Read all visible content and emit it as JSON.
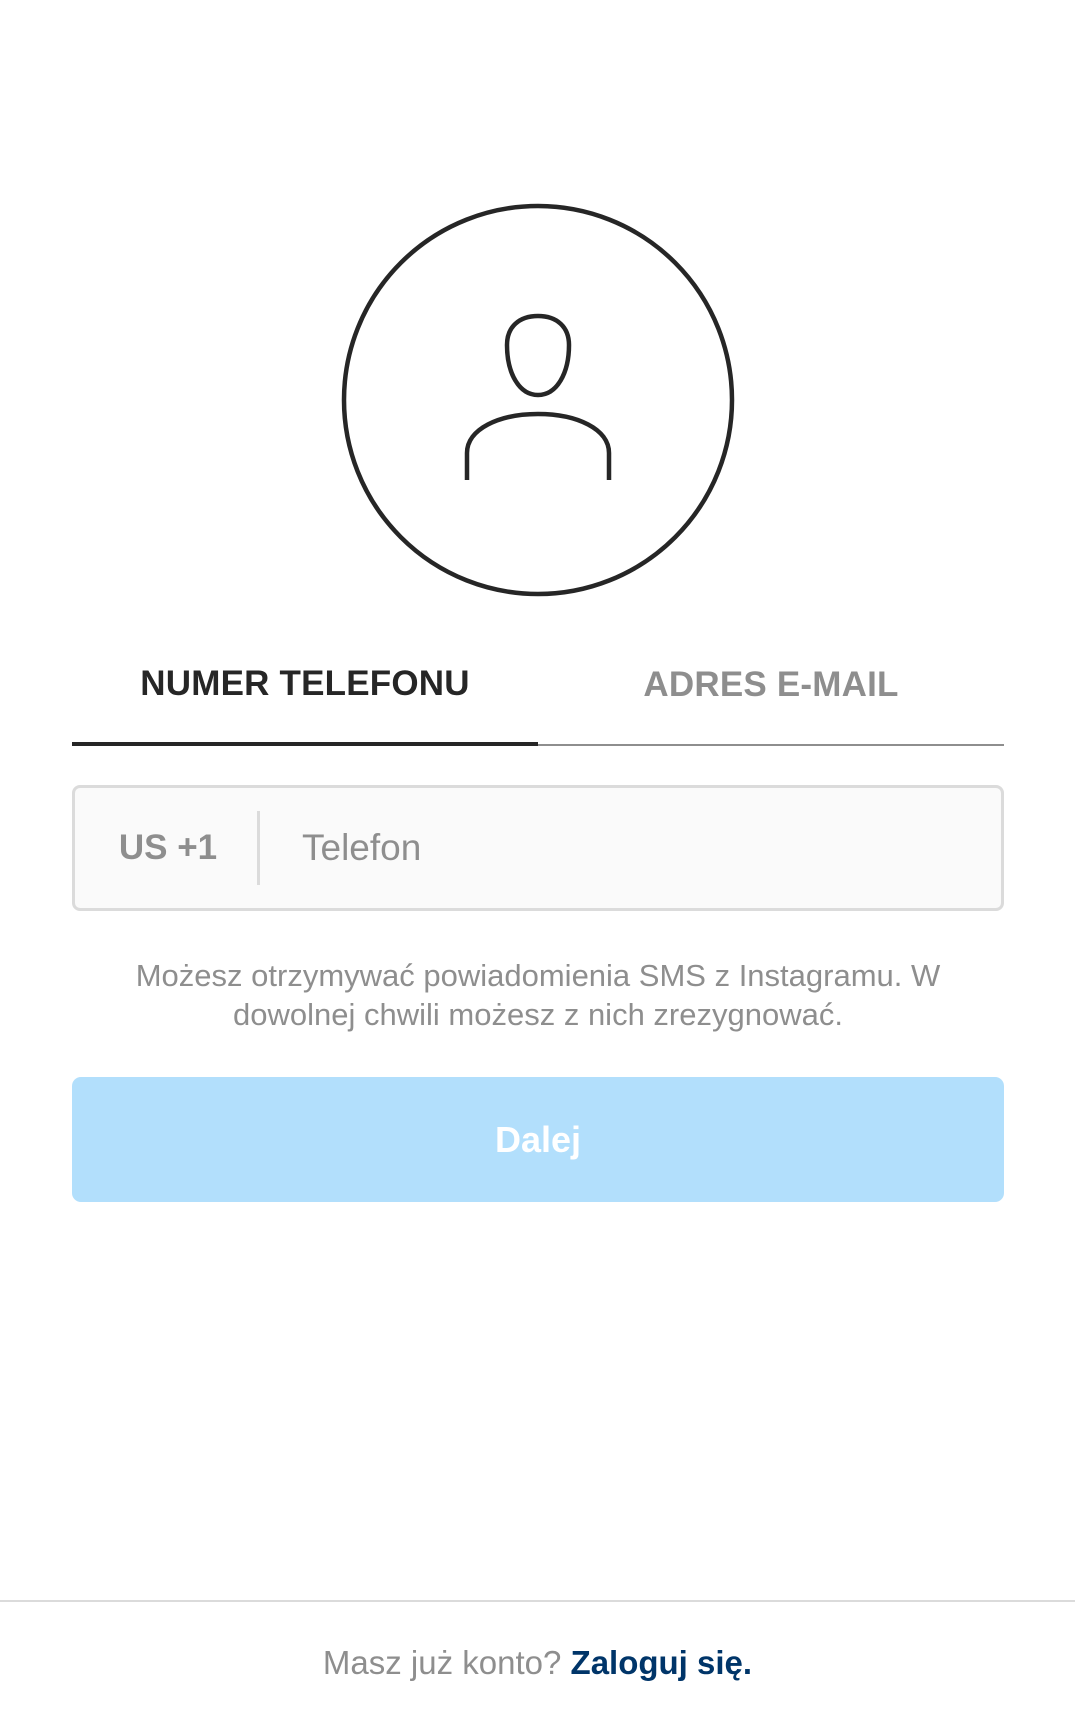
{
  "avatar": {
    "icon": "user-silhouette-icon"
  },
  "tabs": [
    {
      "label": "NUMER TELEFONU",
      "active": true
    },
    {
      "label": "ADRES E-MAIL",
      "active": false
    }
  ],
  "phone": {
    "country_code": "US +1",
    "placeholder": "Telefon",
    "value": ""
  },
  "sms_note": "Możesz otrzymywać powiadomienia SMS z Instagramu. W dowolnej chwili możesz z nich zrezygnować.",
  "next_button": {
    "label": "Dalej",
    "enabled": false,
    "color": "#b2dffc"
  },
  "footer": {
    "prompt": "Masz już konto?",
    "login_label": "Zaloguj się."
  },
  "colors": {
    "text_dark": "#262626",
    "text_muted": "#8e8e8e",
    "link": "#003569",
    "border": "#dbdbdb"
  }
}
